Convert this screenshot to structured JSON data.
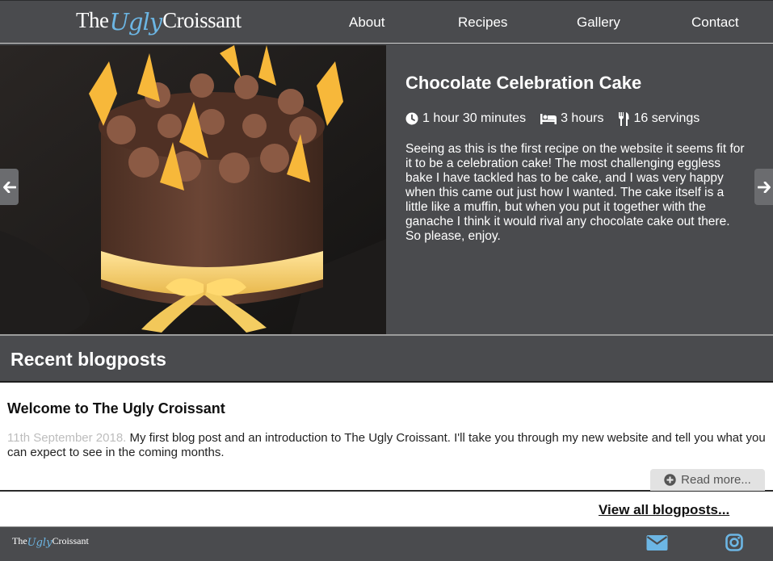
{
  "header": {
    "logo": {
      "part1": "The",
      "part2": "Ugly",
      "part3": "Croissant"
    },
    "nav": [
      {
        "label": "About"
      },
      {
        "label": "Recipes"
      },
      {
        "label": "Gallery"
      },
      {
        "label": "Contact"
      }
    ]
  },
  "hero": {
    "title": "Chocolate Celebration Cake",
    "meta": {
      "prep_time": "1 hour 30 minutes",
      "rest_time": "3 hours",
      "servings": "16 servings"
    },
    "description": "Seeing as this is the first recipe on the website it seems fit for it to be a celebration cake! The most challenging eggless bake I have tackled has to be cake, and I was very happy when this came out just how I wanted. The cake itself is a little like a muffin, but when you put it together with the ganache I think it would rival any chocolate cake out there. So please, enjoy.",
    "icons": {
      "prev": "arrow-left-icon",
      "next": "arrow-right-icon",
      "prep": "clock-icon",
      "rest": "bed-icon",
      "servings": "cutlery-icon"
    }
  },
  "recent": {
    "title": "Recent blogposts",
    "posts": [
      {
        "title": "Welcome to The Ugly Croissant",
        "date": "11th September 2018.",
        "excerpt": "My first blog post and an introduction to The Ugly Croissant. I'll take you through my new website and tell you what you can expect to see in the coming months.",
        "read_more": "Read more..."
      }
    ],
    "view_all": "View all blogposts..."
  },
  "footer": {
    "logo": {
      "part1": "The",
      "part2": "Ugly",
      "part3": "Croissant"
    },
    "icons": [
      "envelope-icon",
      "instagram-icon"
    ]
  },
  "colors": {
    "header_bg": "#4a4b4e",
    "accent_blue": "#6cb6e4",
    "date_grey": "#bdbdbd",
    "button_grey": "#e2e2e2"
  }
}
